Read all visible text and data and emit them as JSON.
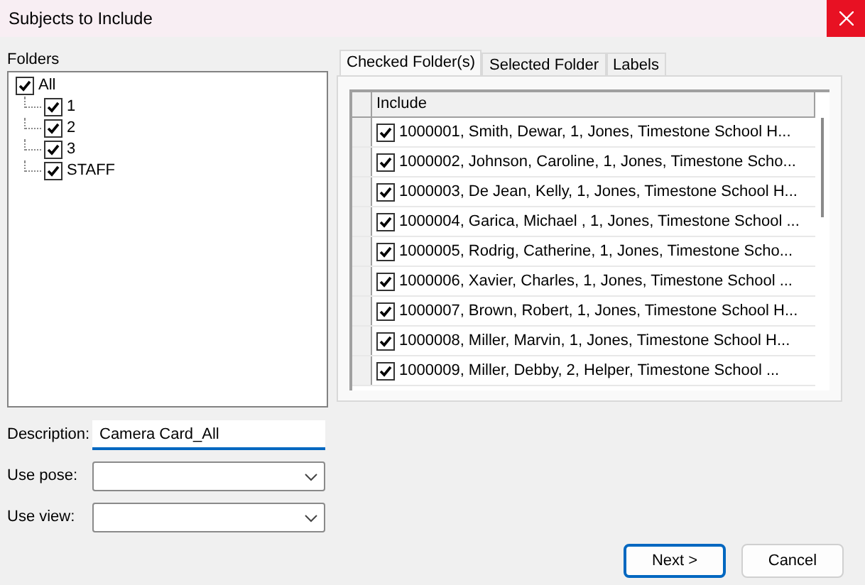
{
  "window": {
    "title": "Subjects to Include"
  },
  "folders": {
    "label": "Folders",
    "tree": [
      {
        "label": "All",
        "checked": true,
        "children": [
          {
            "label": "1",
            "checked": true
          },
          {
            "label": "2",
            "checked": true
          },
          {
            "label": "3",
            "checked": true
          },
          {
            "label": "STAFF",
            "checked": true
          }
        ]
      }
    ]
  },
  "tabs": [
    {
      "label": "Checked Folder(s)",
      "selected": true
    },
    {
      "label": "Selected Folder",
      "selected": false
    },
    {
      "label": "Labels",
      "selected": false
    }
  ],
  "table": {
    "columns": [
      "Include"
    ],
    "rows": [
      {
        "text": "1000001, Smith, Dewar, 1, Jones, Timestone School H...",
        "checked": true
      },
      {
        "text": "1000002, Johnson, Caroline, 1, Jones, Timestone Scho...",
        "checked": true
      },
      {
        "text": "1000003, De Jean, Kelly, 1, Jones, Timestone School H...",
        "checked": true
      },
      {
        "text": "1000004, Garica, Michael , 1, Jones, Timestone School ...",
        "checked": true
      },
      {
        "text": "1000005, Rodrig, Catherine, 1, Jones, Timestone Scho...",
        "checked": true
      },
      {
        "text": "1000006, Xavier, Charles, 1, Jones, Timestone School ...",
        "checked": true
      },
      {
        "text": "1000007, Brown, Robert, 1, Jones, Timestone School H...",
        "checked": true
      },
      {
        "text": "1000008, Miller, Marvin, 1, Jones, Timestone School H...",
        "checked": true
      },
      {
        "text": "1000009, Miller, Debby, 2, Helper, Timestone School ...",
        "checked": true
      }
    ]
  },
  "description": {
    "label": "Description:",
    "value": "Camera Card_All"
  },
  "use_pose": {
    "label": "Use pose:"
  },
  "use_view": {
    "label": "Use view:"
  },
  "buttons": [
    "Next >",
    "Cancel"
  ]
}
